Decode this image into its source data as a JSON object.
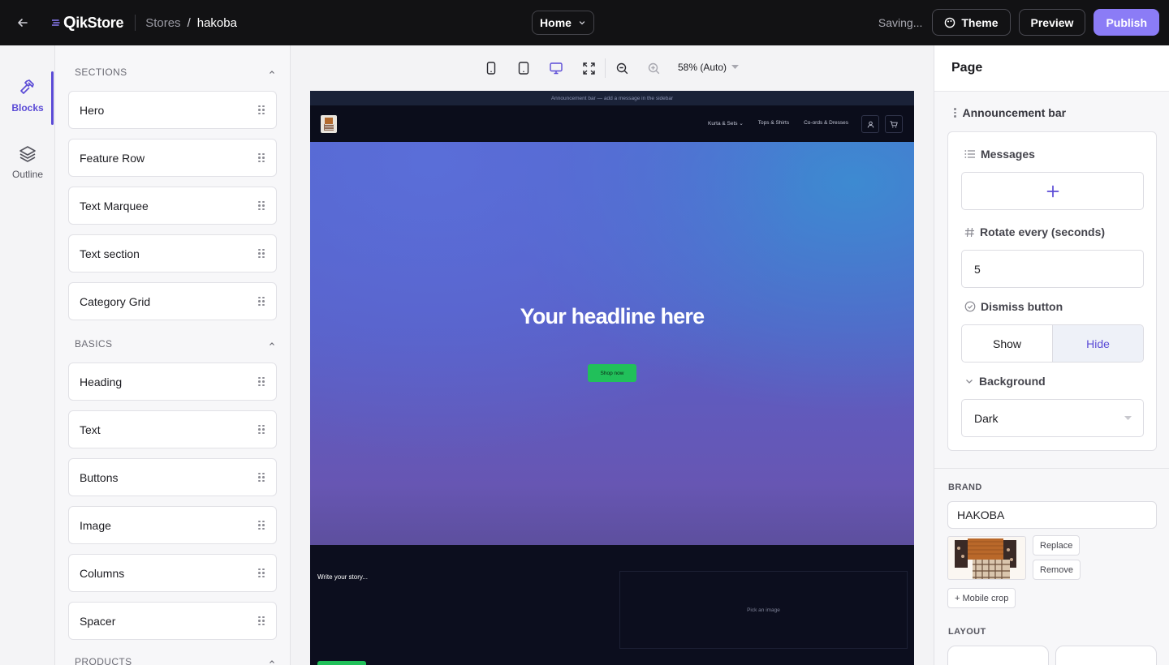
{
  "topbar": {
    "logo_prefix": "Q",
    "logo_text": "ikStore",
    "crumb_root": "Stores",
    "crumb_sep": "/",
    "crumb_current": "hakoba",
    "page_select": "Home",
    "saving": "Saving...",
    "theme": "Theme",
    "preview": "Preview",
    "publish": "Publish",
    "colors": {
      "publish": "#8b7cf6",
      "bar": "#121214"
    }
  },
  "rail": {
    "blocks": "Blocks",
    "outline": "Outline"
  },
  "blocks_panel": {
    "sections_title": "SECTIONS",
    "sections": [
      "Hero",
      "Feature Row",
      "Text Marquee",
      "Text section",
      "Category Grid"
    ],
    "basics_title": "BASICS",
    "basics": [
      "Heading",
      "Text",
      "Buttons",
      "Image",
      "Columns",
      "Spacer"
    ],
    "products_title": "PRODUCTS"
  },
  "canvas": {
    "zoom": "58% (Auto)",
    "announcement": "Announcement bar — add a message in the sidebar",
    "nav": [
      "Kurta & Sets",
      "Tops & Shirts",
      "Co-ords & Dresses"
    ],
    "hero_headline": "Your headline here",
    "hero_button": "Shop now",
    "story_text": "Write your story...",
    "pick_image": "Pick an image",
    "colors": {
      "accent_green": "#21c05a"
    }
  },
  "right_panel": {
    "title": "Page",
    "section_title": "Announcement bar",
    "messages_label": "Messages",
    "rotate_label": "Rotate every (seconds)",
    "rotate_value": "5",
    "dismiss_label": "Dismiss button",
    "dismiss_show": "Show",
    "dismiss_hide": "Hide",
    "background_label": "Background",
    "background_value": "Dark",
    "brand_label": "BRAND",
    "brand_value": "HAKOBA",
    "replace": "Replace",
    "remove": "Remove",
    "mobile_crop": "+ Mobile crop",
    "layout_label": "LAYOUT"
  }
}
